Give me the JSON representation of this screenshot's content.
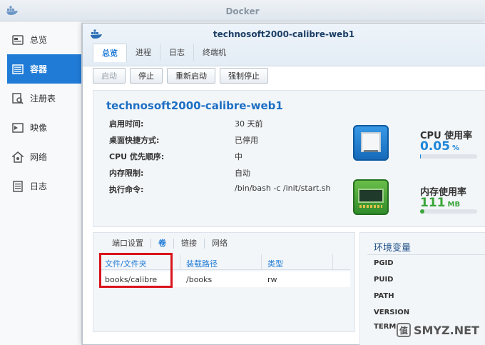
{
  "app": {
    "title": "Docker"
  },
  "sidebar": {
    "items": [
      {
        "label": "总览",
        "icon": "overview-icon"
      },
      {
        "label": "容器",
        "icon": "container-icon",
        "active": true
      },
      {
        "label": "注册表",
        "icon": "registry-icon"
      },
      {
        "label": "映像",
        "icon": "image-icon"
      },
      {
        "label": "网络",
        "icon": "network-icon"
      },
      {
        "label": "日志",
        "icon": "log-icon"
      }
    ]
  },
  "window": {
    "title": "technosoft2000-calibre-web1",
    "tabs": [
      "总览",
      "进程",
      "日志",
      "终端机"
    ],
    "toolbar": {
      "start": "启动",
      "stop": "停止",
      "restart": "重新启动",
      "force_stop": "强制停止"
    }
  },
  "container": {
    "name": "technosoft2000-calibre-web1",
    "fields": [
      {
        "key": "启用时间:",
        "value": "30 天前"
      },
      {
        "key": "桌面快捷方式:",
        "value": "已停用"
      },
      {
        "key": "CPU 优先顺序:",
        "value": "中"
      },
      {
        "key": "内存限制:",
        "value": "自动"
      },
      {
        "key": "执行命令:",
        "value": "/bin/bash -c /init/start.sh"
      }
    ],
    "cpu": {
      "label": "CPU 使用率",
      "value": "0.05",
      "unit": "%",
      "percent": 0.05
    },
    "memory": {
      "label": "内存使用率",
      "value": "111",
      "unit": "MB",
      "percent": 8
    }
  },
  "volumes": {
    "subtabs": [
      "端口设置",
      "卷",
      "链接",
      "网络"
    ],
    "columns": [
      "文件/文件夹",
      "装载路径",
      "类型"
    ],
    "rows": [
      {
        "file": "books/calibre",
        "mount": "/books",
        "type": "rw"
      }
    ]
  },
  "env": {
    "title": "环境变量",
    "items": [
      "PGID",
      "PUID",
      "PATH",
      "VERSION",
      "TERM"
    ]
  },
  "watermark": {
    "text": "SMYZ.NET",
    "glyph": "值"
  },
  "colors": {
    "accent": "#1f7bd6",
    "highlight": "#d9141c",
    "cpu": "#1d86d8",
    "memory": "#3aa53a"
  }
}
